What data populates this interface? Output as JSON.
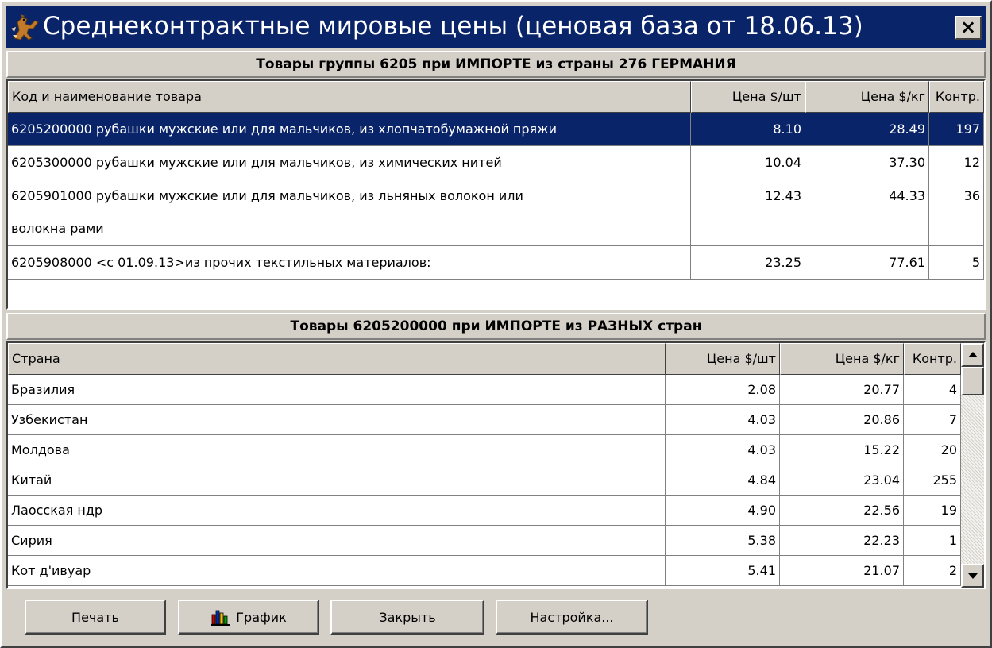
{
  "window": {
    "title": "Среднеконтрактные мировые цены (ценовая база от 18.06.13)",
    "close_label": "×"
  },
  "top_section": {
    "header": "Товары группы 6205 при ИМПОРТЕ из страны 276 ГЕРМАНИЯ",
    "columns": [
      "Код и наименование товара",
      "Цена $/шт",
      "Цена $/кг",
      "Контр."
    ],
    "rows": [
      {
        "name": "6205200000 рубашки мужские или для мальчиков, из хлопчатобумажной пряжи",
        "name2": "",
        "price_unit": "8.10",
        "price_kg": "28.49",
        "contracts": "197",
        "selected": true
      },
      {
        "name": "6205300000 рубашки мужские или для мальчиков, из химических нитей",
        "name2": "",
        "price_unit": "10.04",
        "price_kg": "37.30",
        "contracts": "12",
        "selected": false
      },
      {
        "name": "6205901000 рубашки мужские или для мальчиков, из льняных волокон или",
        "name2": "волокна рами",
        "price_unit": "12.43",
        "price_kg": "44.33",
        "contracts": "36",
        "selected": false
      },
      {
        "name": "6205908000 <с 01.09.13>из прочих текстильных материалов:",
        "name2": "",
        "price_unit": "23.25",
        "price_kg": "77.61",
        "contracts": "5",
        "selected": false
      }
    ]
  },
  "bottom_section": {
    "header": "Товары 6205200000 при ИМПОРТЕ из РАЗНЫХ стран",
    "columns": [
      "Страна",
      "Цена $/шт",
      "Цена $/кг",
      "Контр."
    ],
    "rows": [
      {
        "country": "Бразилия",
        "price_unit": "2.08",
        "price_kg": "20.77",
        "contracts": "4"
      },
      {
        "country": "Узбекистан",
        "price_unit": "4.03",
        "price_kg": "20.86",
        "contracts": "7"
      },
      {
        "country": "Молдова",
        "price_unit": "4.03",
        "price_kg": "15.22",
        "contracts": "20"
      },
      {
        "country": "Китай",
        "price_unit": "4.84",
        "price_kg": "23.04",
        "contracts": "255"
      },
      {
        "country": "Лаосская ндр",
        "price_unit": "4.90",
        "price_kg": "22.56",
        "contracts": "19"
      },
      {
        "country": "Сирия",
        "price_unit": "5.38",
        "price_kg": "22.23",
        "contracts": "1"
      },
      {
        "country": "Кот д'ивуар",
        "price_unit": "5.41",
        "price_kg": "21.07",
        "contracts": "2"
      }
    ]
  },
  "buttons": {
    "print": "Печать",
    "chart": "График",
    "close": "Закрыть",
    "settings": "Настройка..."
  },
  "icons": {
    "app": "dog-runner-icon",
    "chart": "bar-chart-icon",
    "scroll_up": "arrow-up-icon",
    "scroll_down": "arrow-down-icon"
  },
  "colors": {
    "title_bar": "#0a246a",
    "selection": "#0a246a",
    "face": "#d4d0c8"
  }
}
